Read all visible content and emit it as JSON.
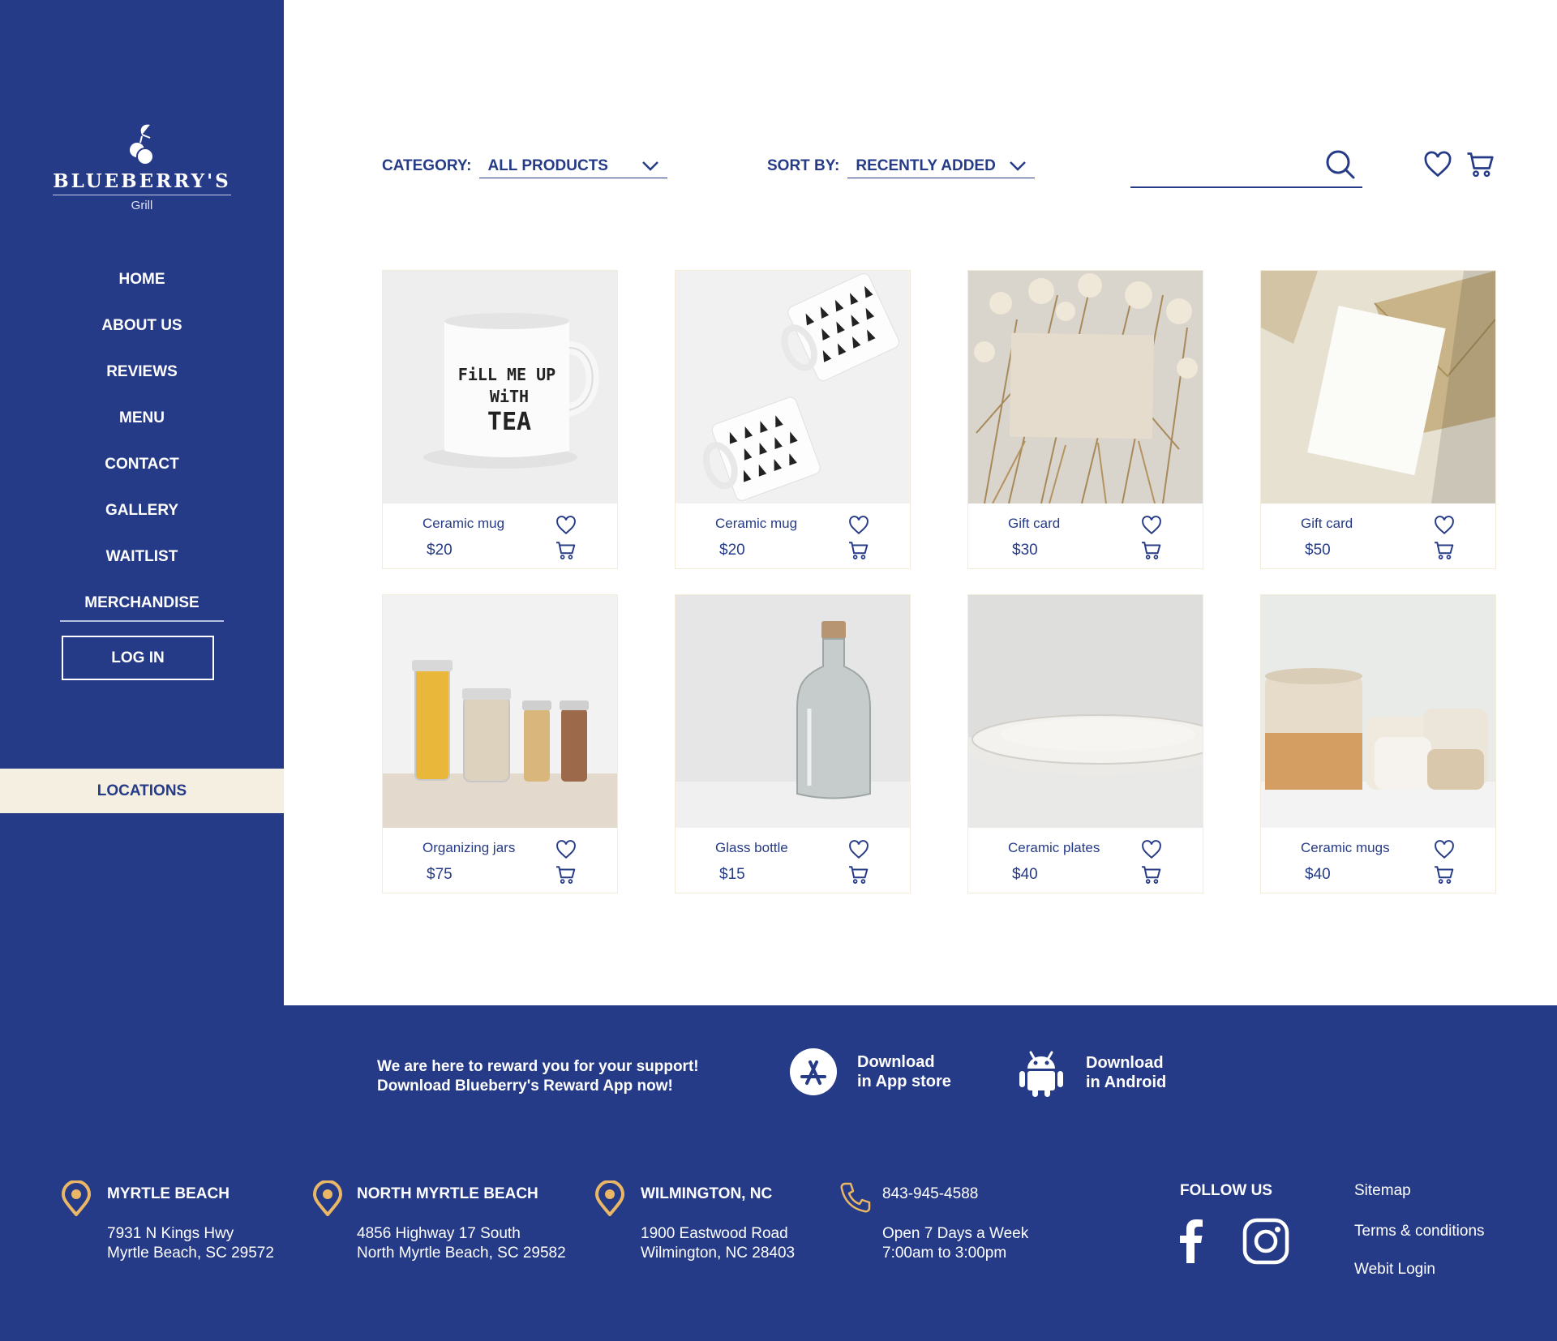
{
  "brand": {
    "name": "BLUEBERRY'S",
    "sub": "Grill"
  },
  "nav": {
    "items": [
      "HOME",
      "ABOUT US",
      "REVIEWS",
      "MENU",
      "CONTACT",
      "GALLERY",
      "WAITLIST",
      "MERCHANDISE"
    ],
    "active": "MERCHANDISE",
    "login": "LOG IN",
    "locations": "LOCATIONS"
  },
  "toolbar": {
    "category_label": "CATEGORY:",
    "category_value": "ALL PRODUCTS",
    "sort_label": "SORT BY:",
    "sort_value": "RECENTLY ADDED",
    "search_placeholder": ""
  },
  "products": [
    {
      "name": "Ceramic mug",
      "price": "$20",
      "image": "mug-fill-me-up-with-tea"
    },
    {
      "name": "Ceramic mug",
      "price": "$20",
      "image": "mugs-tree-pattern"
    },
    {
      "name": "Gift card",
      "price": "$30",
      "image": "gift-card-dried-flowers"
    },
    {
      "name": "Gift card",
      "price": "$50",
      "image": "gift-card-envelope"
    },
    {
      "name": "Organizing jars",
      "price": "$75",
      "image": "glass-jars-pasta"
    },
    {
      "name": "Glass bottle",
      "price": "$15",
      "image": "glass-bottle-cork"
    },
    {
      "name": "Ceramic plates",
      "price": "$40",
      "image": "white-plates"
    },
    {
      "name": "Ceramic mugs",
      "price": "$40",
      "image": "speckled-mugs"
    }
  ],
  "footer": {
    "promo_line1": "We are here to reward you for your support!",
    "promo_line2": "Download Blueberry's Reward App now!",
    "appstore_line1": "Download",
    "appstore_line2": "in App store",
    "android_line1": "Download",
    "android_line2": "in Android",
    "locations": [
      {
        "title": "MYRTLE BEACH",
        "line1": "7931 N Kings Hwy",
        "line2": "Myrtle Beach, SC 29572"
      },
      {
        "title": "NORTH MYRTLE BEACH",
        "line1": "4856 Highway 17 South",
        "line2": "North Myrtle Beach, SC 29582"
      },
      {
        "title": "WILMINGTON, NC",
        "line1": "1900 Eastwood Road",
        "line2": "Wilmington, NC 28403"
      }
    ],
    "phone": "843-945-4588",
    "hours_line1": "Open 7 Days a Week",
    "hours_line2": "7:00am to 3:00pm",
    "follow_us": "FOLLOW US",
    "links": [
      "Sitemap",
      "Terms & conditions",
      "Webit Login"
    ]
  },
  "colors": {
    "primary": "#263b87",
    "accent": "#e9b765",
    "cream": "#f5efe1",
    "white": "#ffffff"
  }
}
